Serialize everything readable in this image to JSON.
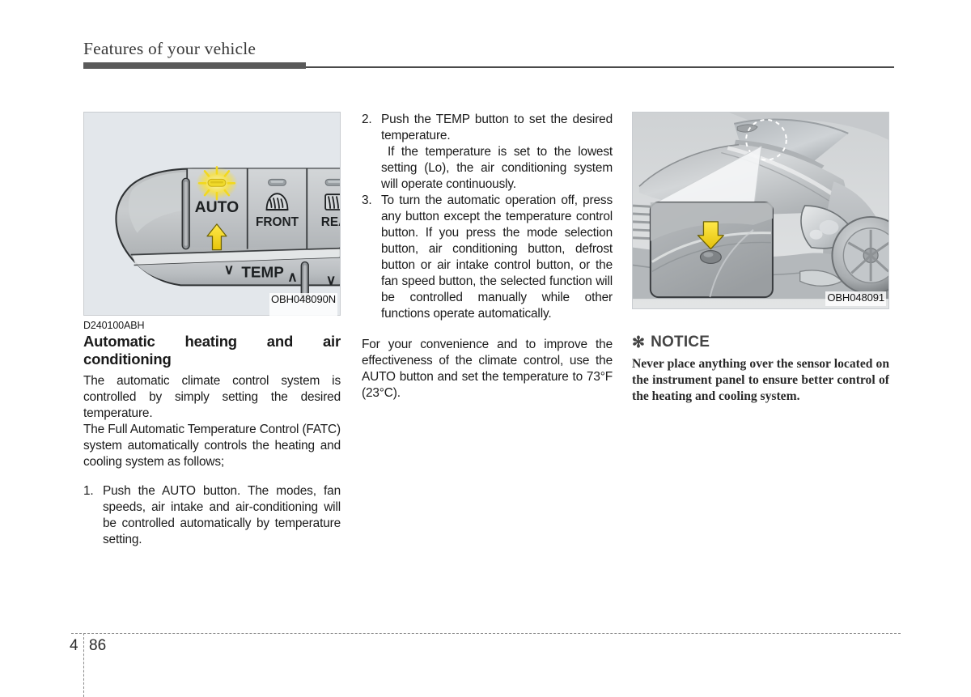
{
  "header": {
    "title": "Features of your vehicle"
  },
  "left_column": {
    "figure": {
      "code": "OBH048090N",
      "caption": "D240100ABH",
      "alt_name": "automatic-climate-control-panel",
      "labels": {
        "auto": "AUTO",
        "front": "FRONT",
        "rear": "REA",
        "temp": "TEMP",
        "temp_down": "∨",
        "temp_up": "∧"
      }
    },
    "heading": "Automatic heating and air conditioning",
    "paragraphs": [
      "The automatic climate control system is controlled by simply setting the desired temperature.",
      "The Full Automatic Temperature Control (FATC) system automatically controls the heating and cooling system as follows;"
    ],
    "list": [
      {
        "num": "1.",
        "text": "Push the AUTO button. The modes, fan speeds, air intake and air-conditioning will be controlled automatically by temperature setting."
      }
    ]
  },
  "middle_column": {
    "list": [
      {
        "num": "2.",
        "text": "Push the TEMP button to set the desired temperature.",
        "sub": "If the temperature is set to the lowest setting (Lo), the air conditioning system will operate continuously."
      },
      {
        "num": "3.",
        "text": "To turn the automatic operation off, press any button except the temperature control button. If you press the mode selection button, air conditioning button, defrost button or air intake control button, or the fan speed button, the selected function will be controlled manually while other functions operate automatically."
      }
    ],
    "paragraph": "For your convenience and to improve the effectiveness of the climate control, use the AUTO button and set the temperature to 73°F (23°C)."
  },
  "right_column": {
    "figure": {
      "code": "OBH048091",
      "alt_name": "vehicle-front-sensor-location"
    },
    "notice": {
      "star": "✻",
      "title": "NOTICE",
      "text": "Never place anything over the sensor located on the instrument panel to ensure better control of the heating and cooling system."
    }
  },
  "footer": {
    "chapter": "4",
    "page": "86"
  },
  "colors": {
    "header_bar": "#5a5a5a",
    "accent_yellow": "#f5e03c",
    "notice_gray": "#444444",
    "figure_bg": "#e4e8ec"
  }
}
